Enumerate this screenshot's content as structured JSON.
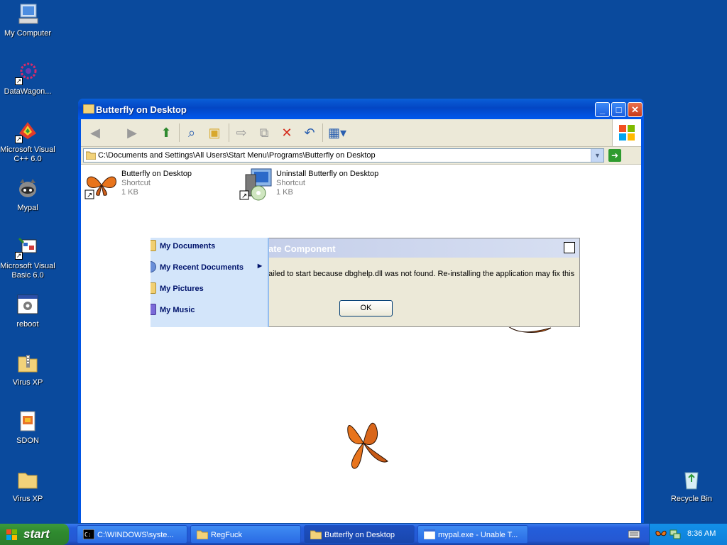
{
  "desktop": {
    "icons": [
      {
        "label": "My Computer",
        "icon": "my-computer-icon"
      },
      {
        "label": "DataWagon...",
        "icon": "datawagon-icon"
      },
      {
        "label": "Microsoft Visual\nC++ 6.0",
        "icon": "visual-cpp-icon"
      },
      {
        "label": "Mypal",
        "icon": "mypal-raccoon-icon"
      },
      {
        "label": "Microsoft Visual\nBasic 6.0",
        "icon": "visual-basic-icon"
      },
      {
        "label": "reboot",
        "icon": "reboot-icon"
      },
      {
        "label": "Virus XP",
        "icon": "zip-folder-icon"
      },
      {
        "label": "SDON",
        "icon": "sdon-file-icon"
      },
      {
        "label": "Virus XP",
        "icon": "folder-icon"
      },
      {
        "label": "Recycle Bin",
        "icon": "recycle-bin-icon"
      }
    ]
  },
  "window": {
    "title": "Butterfly on Desktop",
    "address": "C:\\Documents and Settings\\All Users\\Start Menu\\Programs\\Butterfly on Desktop",
    "files": [
      {
        "name": "Butterfly on Desktop",
        "type": "Shortcut",
        "size": "1 KB"
      },
      {
        "name": "Uninstall Butterfly on Desktop",
        "type": "Shortcut",
        "size": "1 KB"
      }
    ]
  },
  "dialog": {
    "title": "ate Component",
    "message": "ailed to start because dbghelp.dll was not found. Re-installing the application may fix this",
    "ok_label": "OK"
  },
  "start_menu": {
    "items": [
      "My Documents",
      "My Recent Documents",
      "My Pictures",
      "My Music"
    ]
  },
  "taskbar": {
    "start_label": "start",
    "buttons": [
      {
        "label": "C:\\WINDOWS\\syste...",
        "icon": "console-icon"
      },
      {
        "label": "RegFuck",
        "icon": "folder-icon"
      },
      {
        "label": "Butterfly on Desktop",
        "icon": "folder-icon"
      },
      {
        "label": "mypal.exe - Unable T...",
        "icon": "window-icon"
      }
    ],
    "clock": "8:36 AM"
  }
}
